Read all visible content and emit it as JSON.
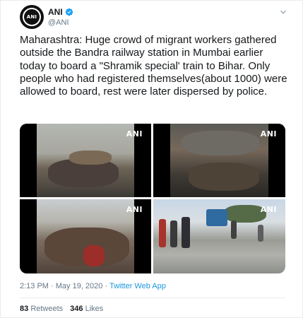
{
  "tweet": {
    "display_name": "ANI",
    "handle": "@ANI",
    "avatar_text": "ANI",
    "verified": true,
    "text": "Maharashtra: Huge crowd of migrant workers gathered outside the Bandra railway station in Mumbai earlier today to board a \"Shramik special' train to Bihar. Only people who had registered themselves(about 1000) were allowed to board, rest were later dispersed by police.",
    "media": [
      {
        "watermark": "ANI"
      },
      {
        "watermark": "ANI"
      },
      {
        "watermark": "ANI"
      },
      {
        "watermark": "ANI"
      }
    ],
    "timestamp": "2:13 PM · May 19, 2020 ·",
    "source": "Twitter Web App",
    "retweets_count": "83",
    "retweets_label": "Retweets",
    "likes_count": "346",
    "likes_label": "Likes"
  },
  "icons": {
    "verified": "verified-badge-icon",
    "caret": "chevron-down-icon"
  },
  "colors": {
    "link": "#1b95e0",
    "secondary_text": "#657786",
    "primary_text": "#14171a",
    "verified": "#1da1f2"
  }
}
